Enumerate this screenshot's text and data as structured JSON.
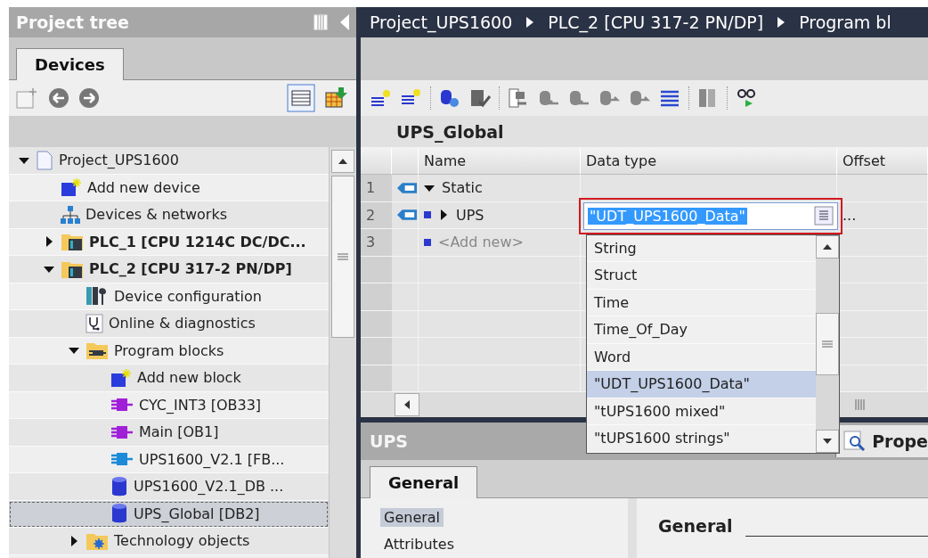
{
  "project_tree": {
    "title": "Project tree",
    "tabs": [
      {
        "label": "Devices",
        "selected": true
      }
    ],
    "items": [
      {
        "label": "Project_UPS1600",
        "kind": "project",
        "expanded": true,
        "selected": false,
        "children": [
          {
            "label": "Add new device",
            "kind": "add",
            "selected": false
          },
          {
            "label": "Devices & networks",
            "kind": "network",
            "selected": false
          },
          {
            "label": "PLC_1 [CPU 1214C DC/DC...",
            "kind": "plc",
            "expanded": false,
            "selected": false
          },
          {
            "label": "PLC_2 [CPU 317-2 PN/DP]",
            "kind": "plc",
            "expanded": true,
            "selected": false,
            "children": [
              {
                "label": "Device configuration",
                "kind": "config",
                "selected": false
              },
              {
                "label": "Online & diagnostics",
                "kind": "diag",
                "selected": false
              },
              {
                "label": "Program blocks",
                "kind": "folder",
                "expanded": true,
                "selected": false,
                "children": [
                  {
                    "label": "Add new block",
                    "kind": "add",
                    "selected": false
                  },
                  {
                    "label": "CYC_INT3 [OB33]",
                    "kind": "ob",
                    "selected": false
                  },
                  {
                    "label": "Main [OB1]",
                    "kind": "ob",
                    "selected": false
                  },
                  {
                    "label": "UPS1600_V2.1 [FB...",
                    "kind": "fb",
                    "selected": false
                  },
                  {
                    "label": "UPS1600_V2.1_DB ...",
                    "kind": "db",
                    "selected": false
                  },
                  {
                    "label": "UPS_Global [DB2]",
                    "kind": "db",
                    "selected": true
                  }
                ]
              },
              {
                "label": "Technology objects",
                "kind": "techfolder",
                "expanded": false,
                "selected": false
              }
            ]
          }
        ]
      }
    ]
  },
  "breadcrumb": [
    "Project_UPS1600",
    "PLC_2 [CPU 317-2 PN/DP]",
    "Program bl"
  ],
  "editor": {
    "title": "UPS_Global",
    "columns": [
      "Name",
      "Data type",
      "Offset"
    ],
    "rows": [
      {
        "number": "1",
        "kind": "section",
        "name": "Static",
        "expanded": true
      },
      {
        "number": "2",
        "kind": "member",
        "name": "UPS",
        "expanded": false,
        "data_type": "\"UDT_UPS1600_Data\"",
        "offset": "...",
        "editing": true
      },
      {
        "number": "3",
        "kind": "add",
        "name": "<Add new>"
      }
    ],
    "dropdown": [
      {
        "label": "String",
        "selected": false
      },
      {
        "label": "Struct",
        "selected": false
      },
      {
        "label": "Time",
        "selected": false
      },
      {
        "label": "Time_Of_Day",
        "selected": false
      },
      {
        "label": "Word",
        "selected": false
      },
      {
        "label": "\"UDT_UPS1600_Data\"",
        "selected": true
      },
      {
        "label": "\"tUPS1600 mixed\"",
        "selected": false
      },
      {
        "label": "\"tUPS1600 strings\"",
        "selected": false
      }
    ]
  },
  "inspector": {
    "title": "UPS",
    "properties_tab": "Prope",
    "tabs": [
      {
        "label": "General",
        "selected": true
      }
    ],
    "sections": [
      {
        "label": "General",
        "selected": true
      },
      {
        "label": "Attributes",
        "selected": false
      }
    ],
    "heading": "General"
  }
}
